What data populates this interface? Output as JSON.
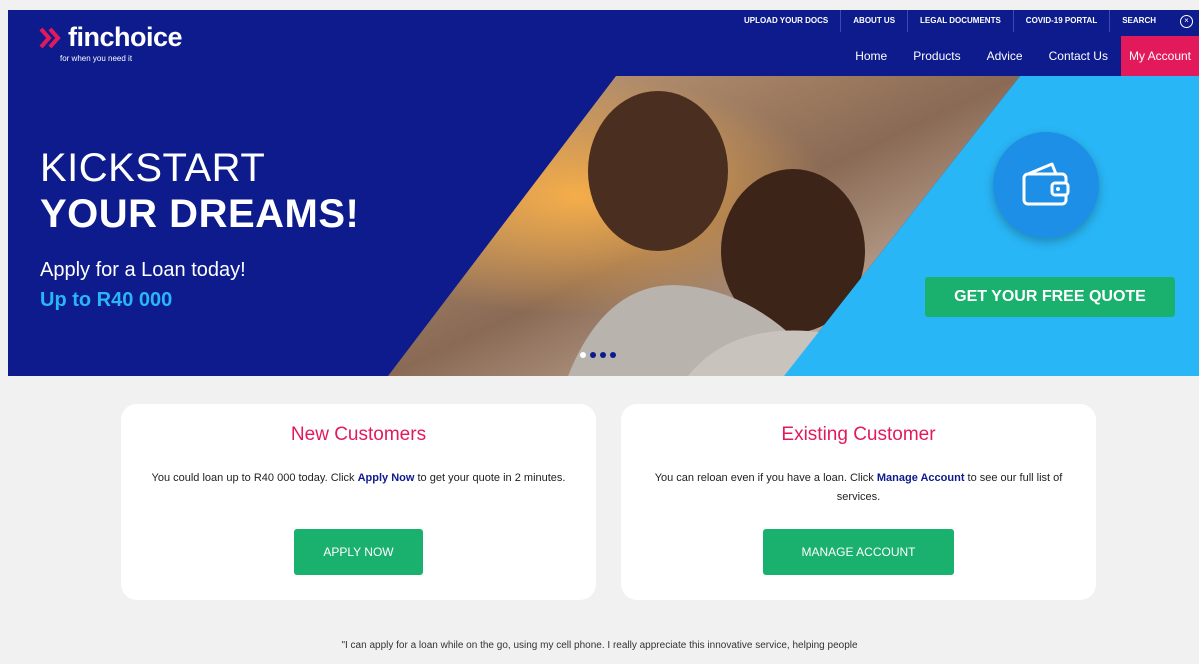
{
  "logo": {
    "name": "finchoice",
    "tagline": "for when you need it"
  },
  "top_links": [
    "UPLOAD YOUR DOCS",
    "ABOUT US",
    "LEGAL DOCUMENTS",
    "COVID-19 PORTAL",
    "SEARCH"
  ],
  "main_nav": [
    "Home",
    "Products",
    "Advice",
    "Contact Us",
    "My Account"
  ],
  "hero": {
    "line1": "KICKSTART",
    "line2": "YOUR DREAMS!",
    "sub": "Apply for a Loan today!",
    "amount": "Up to R40 000",
    "cta": "GET YOUR FREE QUOTE",
    "slide_count": 4,
    "active_slide": 1
  },
  "new_customers": {
    "title": "New Customers",
    "text_a": "You could loan up to R40 000 today. Click ",
    "text_bold": "Apply Now",
    "text_b": " to get your quote in 2 minutes.",
    "button": "APPLY NOW"
  },
  "existing_customer": {
    "title": "Existing Customer",
    "text_a": "You can reloan even if you have a loan. Click ",
    "text_bold": "Manage Account",
    "text_b": " to see our full list of services.",
    "button": "MANAGE ACCOUNT"
  },
  "testimonial": "\"I can apply for a loan while on the go, using my cell phone. I really appreciate this innovative service, helping people",
  "colors": {
    "brand_blue": "#0d1b8c",
    "accent_pink": "#e21a5b",
    "cta_green": "#1ab06e",
    "sky_blue": "#29b6f6"
  }
}
